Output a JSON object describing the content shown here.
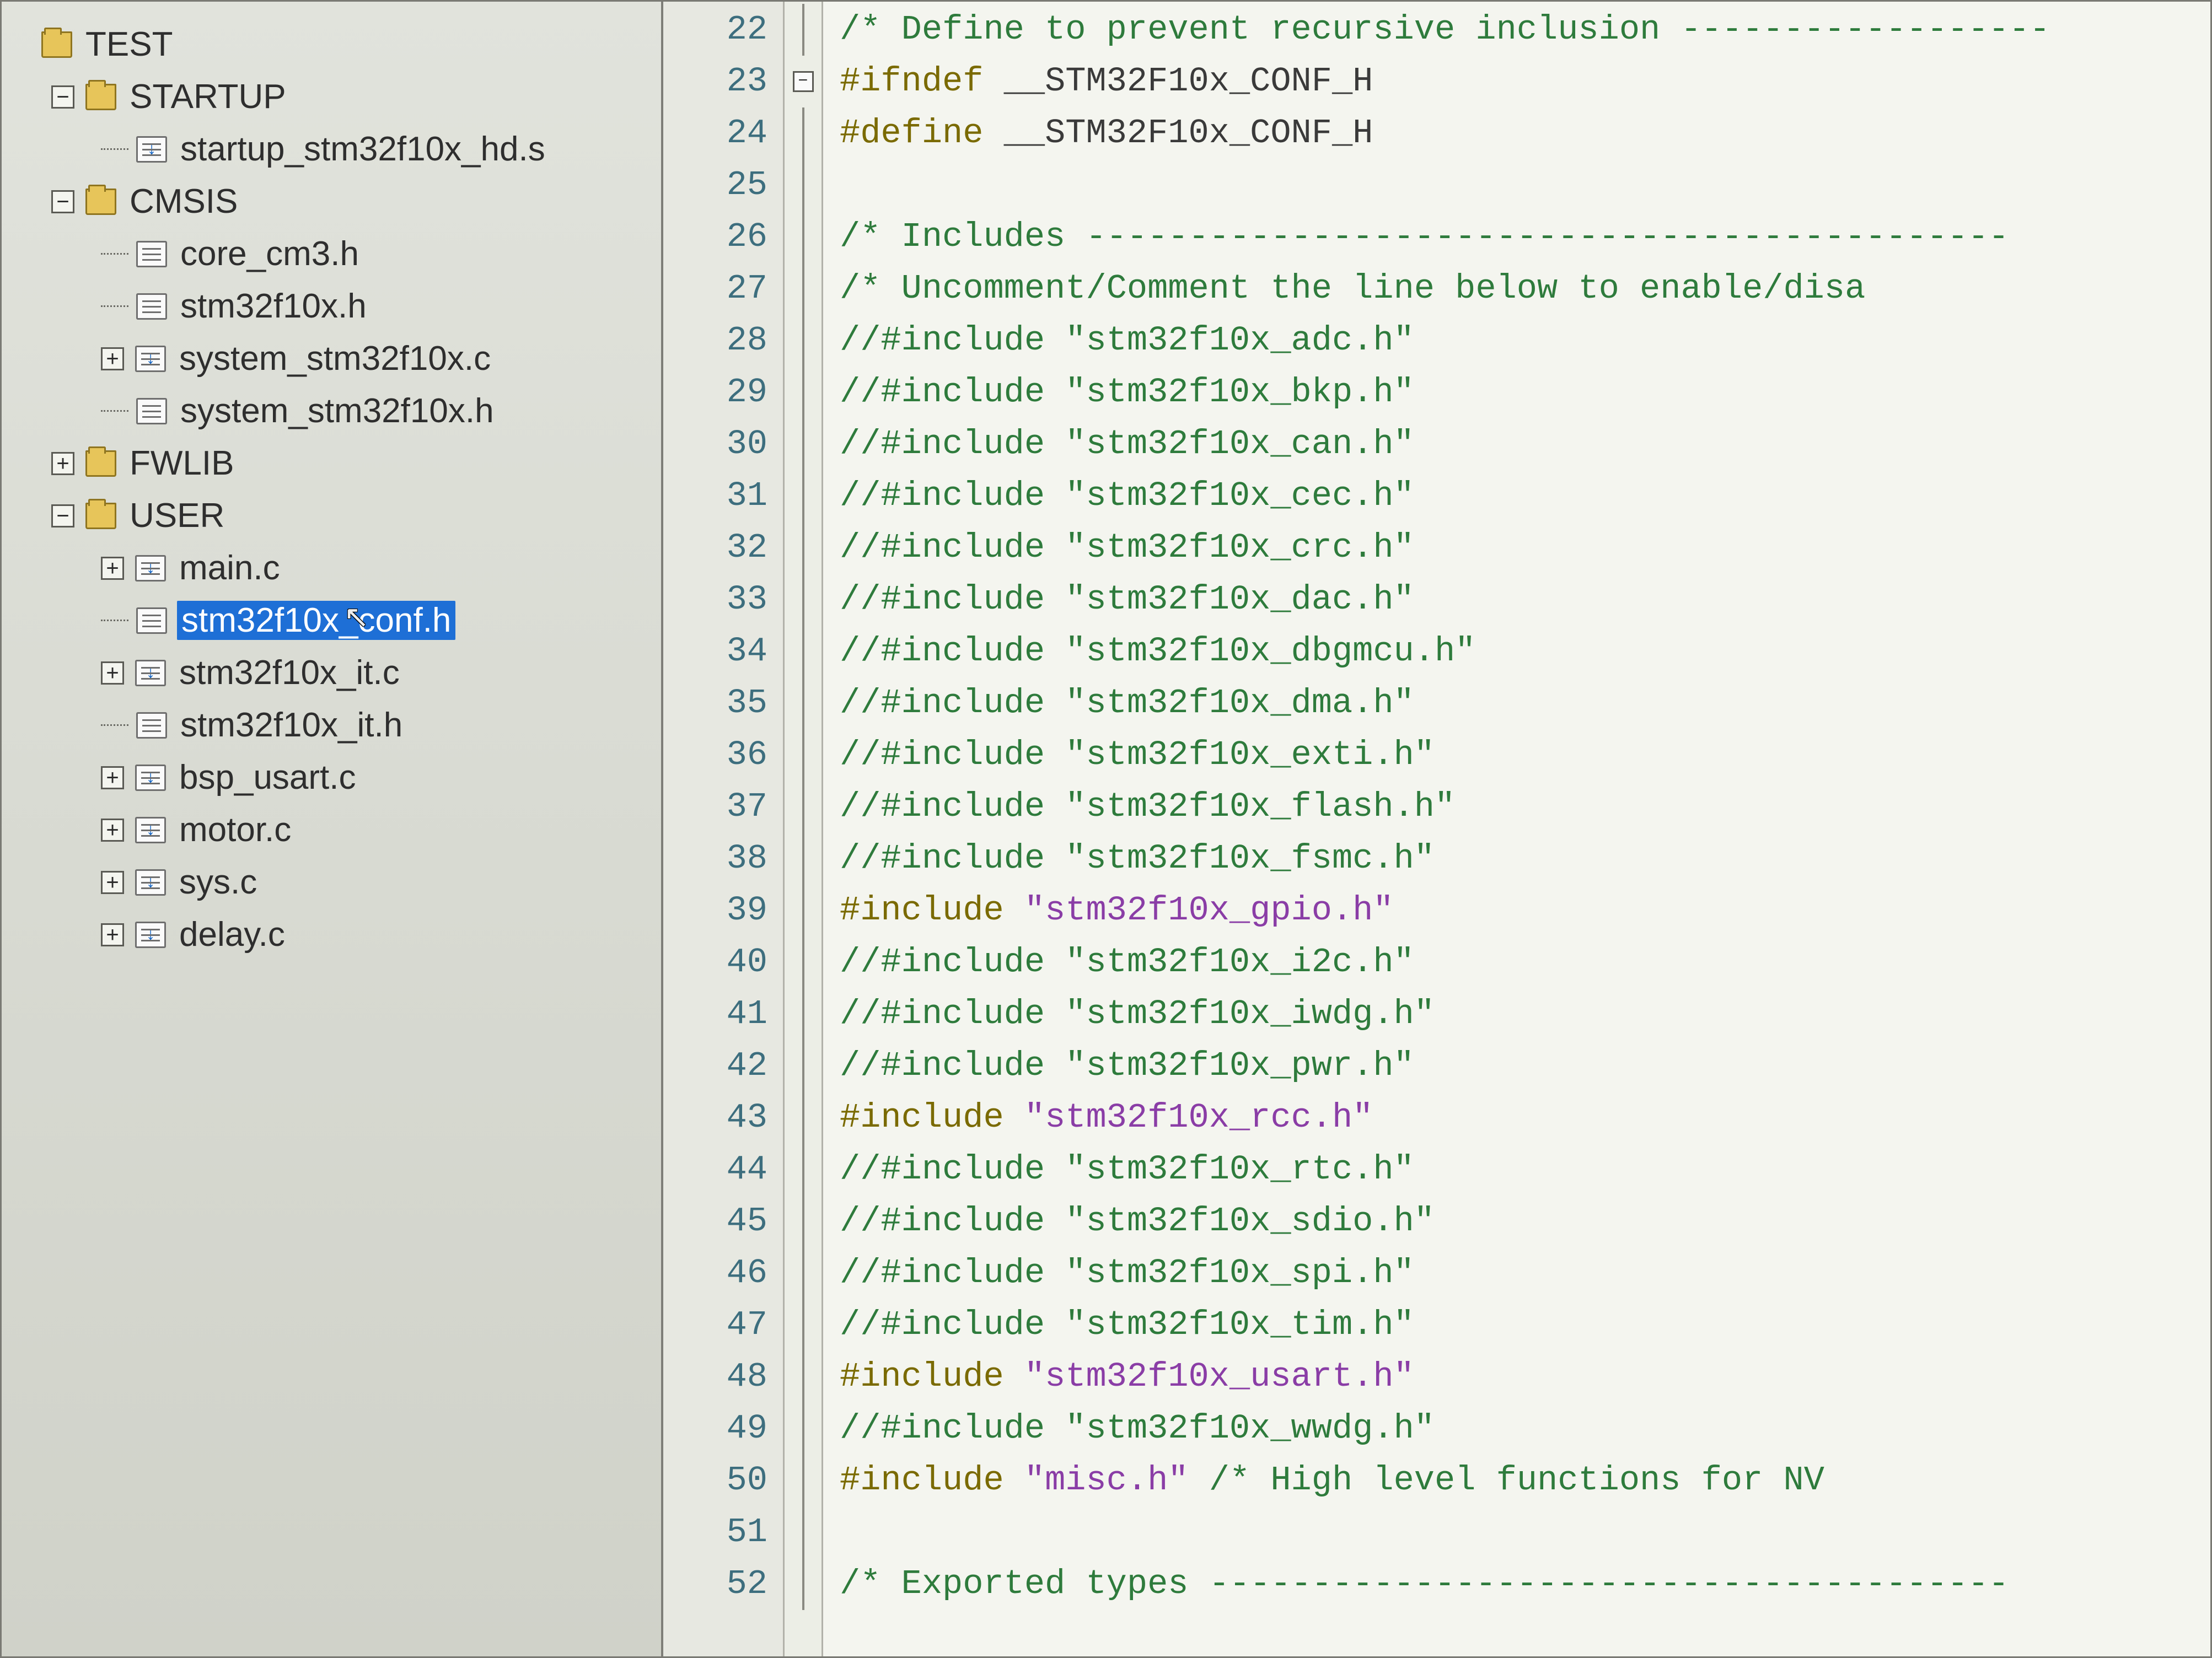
{
  "tree": {
    "root": "TEST",
    "nodes": [
      {
        "id": "test",
        "label": "TEST",
        "level": 0,
        "kind": "folder",
        "exp": "none"
      },
      {
        "id": "startup",
        "label": "STARTUP",
        "level": 1,
        "kind": "folder",
        "exp": "minus"
      },
      {
        "id": "startup_s",
        "label": "startup_stm32f10x_hd.s",
        "level": 2,
        "kind": "filedl",
        "exp": "dot"
      },
      {
        "id": "cmsis",
        "label": "CMSIS",
        "level": 1,
        "kind": "folder",
        "exp": "minus"
      },
      {
        "id": "corecm3",
        "label": "core_cm3.h",
        "level": 2,
        "kind": "file",
        "exp": "dot"
      },
      {
        "id": "stmh",
        "label": "stm32f10x.h",
        "level": 2,
        "kind": "file",
        "exp": "dot"
      },
      {
        "id": "sysc",
        "label": "system_stm32f10x.c",
        "level": 2,
        "kind": "filedl",
        "exp": "plus"
      },
      {
        "id": "sysh",
        "label": "system_stm32f10x.h",
        "level": 2,
        "kind": "file",
        "exp": "dot"
      },
      {
        "id": "fwlb",
        "label": "FWLIB",
        "level": 1,
        "kind": "folder",
        "exp": "plus"
      },
      {
        "id": "user",
        "label": "USER",
        "level": 1,
        "kind": "folder",
        "exp": "minus"
      },
      {
        "id": "mainc",
        "label": "main.c",
        "level": 2,
        "kind": "filedl",
        "exp": "plus"
      },
      {
        "id": "confh",
        "label": "stm32f10x_conf.h",
        "level": 2,
        "kind": "file",
        "exp": "dot",
        "selected": true
      },
      {
        "id": "itc",
        "label": "stm32f10x_it.c",
        "level": 2,
        "kind": "filedl",
        "exp": "plus"
      },
      {
        "id": "ith",
        "label": "stm32f10x_it.h",
        "level": 2,
        "kind": "file",
        "exp": "dot"
      },
      {
        "id": "bsp",
        "label": "bsp_usart.c",
        "level": 2,
        "kind": "filedl",
        "exp": "plus"
      },
      {
        "id": "motor",
        "label": "motor.c",
        "level": 2,
        "kind": "filedl",
        "exp": "plus"
      },
      {
        "id": "sys",
        "label": "sys.c",
        "level": 2,
        "kind": "filedl",
        "exp": "plus"
      },
      {
        "id": "delay",
        "label": "delay.c",
        "level": 2,
        "kind": "filedl",
        "exp": "plus"
      }
    ]
  },
  "code": {
    "first_line": 22,
    "fold_minus_at": 23,
    "lines": [
      {
        "n": 22,
        "t": [
          [
            "comment",
            "/* Define to prevent recursive inclusion ------------------"
          ]
        ]
      },
      {
        "n": 23,
        "t": [
          [
            "preproc",
            "#ifndef "
          ],
          [
            "plain",
            "__STM32F10x_CONF_H"
          ]
        ]
      },
      {
        "n": 24,
        "t": [
          [
            "preproc",
            "#define "
          ],
          [
            "plain",
            "__STM32F10x_CONF_H"
          ]
        ]
      },
      {
        "n": 25,
        "t": [
          [
            "plain",
            ""
          ]
        ]
      },
      {
        "n": 26,
        "t": [
          [
            "comment",
            "/* Includes ---------------------------------------------"
          ]
        ]
      },
      {
        "n": 27,
        "t": [
          [
            "comment",
            "/* Uncomment/Comment the line below to enable/disa"
          ]
        ]
      },
      {
        "n": 28,
        "t": [
          [
            "comment",
            "//#include \"stm32f10x_adc.h\""
          ]
        ]
      },
      {
        "n": 29,
        "t": [
          [
            "comment",
            "//#include \"stm32f10x_bkp.h\""
          ]
        ]
      },
      {
        "n": 30,
        "t": [
          [
            "comment",
            "//#include \"stm32f10x_can.h\""
          ]
        ]
      },
      {
        "n": 31,
        "t": [
          [
            "comment",
            "//#include \"stm32f10x_cec.h\""
          ]
        ]
      },
      {
        "n": 32,
        "t": [
          [
            "comment",
            "//#include \"stm32f10x_crc.h\""
          ]
        ]
      },
      {
        "n": 33,
        "t": [
          [
            "comment",
            "//#include \"stm32f10x_dac.h\""
          ]
        ]
      },
      {
        "n": 34,
        "t": [
          [
            "comment",
            "//#include \"stm32f10x_dbgmcu.h\""
          ]
        ]
      },
      {
        "n": 35,
        "t": [
          [
            "comment",
            "//#include \"stm32f10x_dma.h\""
          ]
        ]
      },
      {
        "n": 36,
        "t": [
          [
            "comment",
            "//#include \"stm32f10x_exti.h\""
          ]
        ]
      },
      {
        "n": 37,
        "t": [
          [
            "comment",
            "//#include \"stm32f10x_flash.h\""
          ]
        ]
      },
      {
        "n": 38,
        "t": [
          [
            "comment",
            "//#include \"stm32f10x_fsmc.h\""
          ]
        ]
      },
      {
        "n": 39,
        "t": [
          [
            "include",
            "#include "
          ],
          [
            "string",
            "\"stm32f10x_gpio.h\""
          ]
        ]
      },
      {
        "n": 40,
        "t": [
          [
            "comment",
            "//#include \"stm32f10x_i2c.h\""
          ]
        ]
      },
      {
        "n": 41,
        "t": [
          [
            "comment",
            "//#include \"stm32f10x_iwdg.h\""
          ]
        ]
      },
      {
        "n": 42,
        "t": [
          [
            "comment",
            "//#include \"stm32f10x_pwr.h\""
          ]
        ]
      },
      {
        "n": 43,
        "t": [
          [
            "include",
            "#include "
          ],
          [
            "string",
            "\"stm32f10x_rcc.h\""
          ]
        ]
      },
      {
        "n": 44,
        "t": [
          [
            "comment",
            "//#include \"stm32f10x_rtc.h\""
          ]
        ]
      },
      {
        "n": 45,
        "t": [
          [
            "comment",
            "//#include \"stm32f10x_sdio.h\""
          ]
        ]
      },
      {
        "n": 46,
        "t": [
          [
            "comment",
            "//#include \"stm32f10x_spi.h\""
          ]
        ]
      },
      {
        "n": 47,
        "t": [
          [
            "comment",
            "//#include \"stm32f10x_tim.h\""
          ]
        ]
      },
      {
        "n": 48,
        "t": [
          [
            "include",
            "#include "
          ],
          [
            "string",
            "\"stm32f10x_usart.h\""
          ]
        ]
      },
      {
        "n": 49,
        "t": [
          [
            "comment",
            "//#include \"stm32f10x_wwdg.h\""
          ]
        ]
      },
      {
        "n": 50,
        "t": [
          [
            "include",
            "#include "
          ],
          [
            "string",
            "\"misc.h\""
          ],
          [
            "comment",
            " /* High level functions for NV"
          ]
        ]
      },
      {
        "n": 51,
        "t": [
          [
            "plain",
            ""
          ]
        ]
      },
      {
        "n": 52,
        "t": [
          [
            "comment",
            "/* Exported types ---------------------------------------"
          ]
        ]
      }
    ]
  },
  "colors": {
    "selection": "#1e6fd6",
    "comment": "#2e7b3c",
    "preproc": "#7a6a00",
    "string": "#8a3da6"
  }
}
